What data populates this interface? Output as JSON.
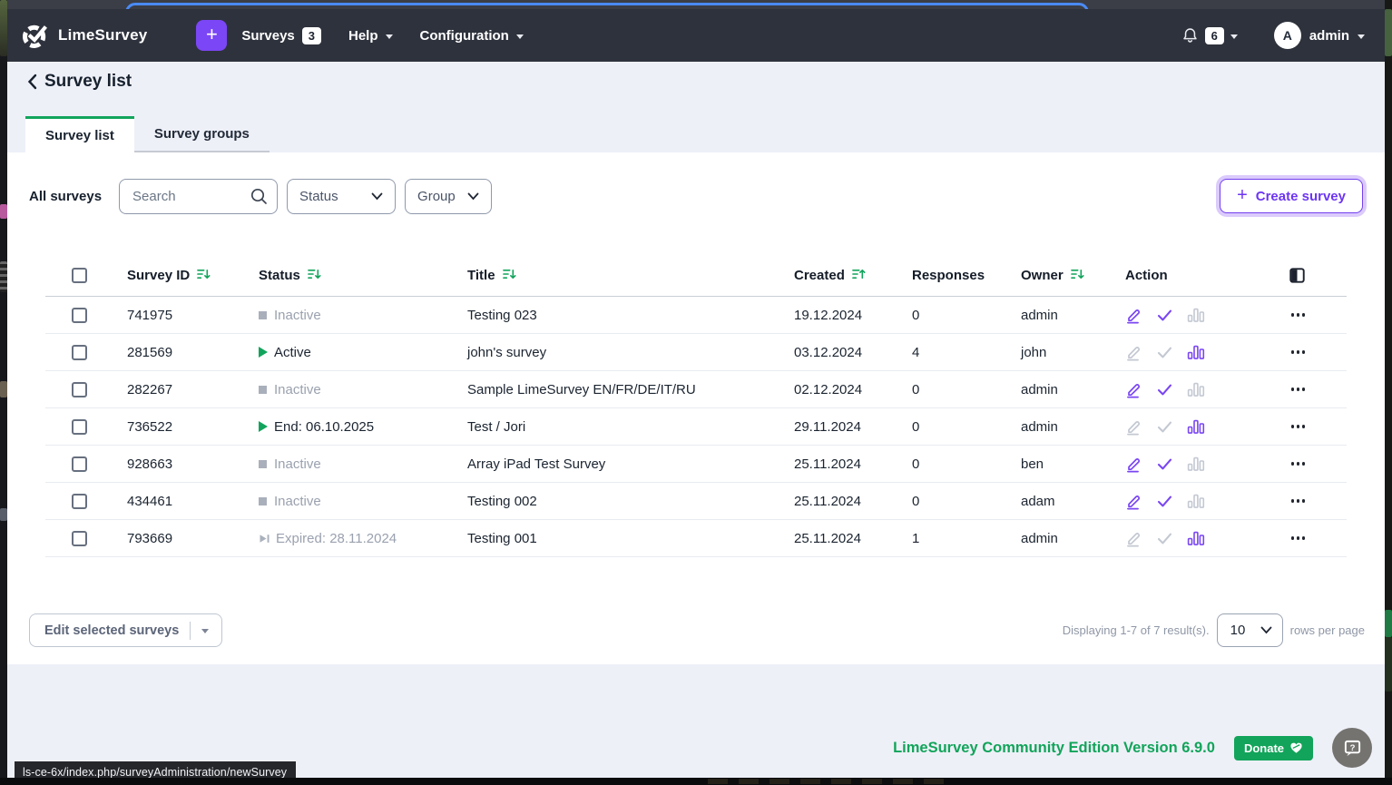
{
  "theme": {
    "accent_purple": "#7b46f5",
    "accent_green": "#12a45c",
    "navbar_bg": "#2e323c",
    "page_bg": "#eef0f8",
    "muted_text": "#9aa1ae"
  },
  "browser": {
    "status_bar_url": "ls-ce-6x/index.php/surveyAdministration/newSurvey"
  },
  "navbar": {
    "brand": "LimeSurvey",
    "plus_label": "+",
    "surveys_label": "Surveys",
    "surveys_badge": "3",
    "help_label": "Help",
    "config_label": "Configuration",
    "notifications_count": "6",
    "user_initial": "A",
    "user_name": "admin"
  },
  "page": {
    "back_title": "Survey list"
  },
  "tabs": [
    {
      "label": "Survey list"
    },
    {
      "label": "Survey groups"
    }
  ],
  "filters": {
    "scope_label": "All surveys",
    "search_placeholder": "Search",
    "status_placeholder": "Status",
    "group_placeholder": "Group",
    "create_button_label": "Create survey"
  },
  "table": {
    "columns": [
      {
        "label": "Survey ID",
        "sort": "down"
      },
      {
        "label": "Status",
        "sort": "down"
      },
      {
        "label": "Title",
        "sort": "down"
      },
      {
        "label": "Created",
        "sort": "up"
      },
      {
        "label": "Responses",
        "sort": null
      },
      {
        "label": "Owner",
        "sort": "down"
      },
      {
        "label": "Action",
        "sort": null
      }
    ],
    "rows": [
      {
        "id": "741975",
        "status_text": "Inactive",
        "status_type": "inactive",
        "title": "Testing 023",
        "created": "19.12.2024",
        "responses": "0",
        "owner": "admin"
      },
      {
        "id": "281569",
        "status_text": "Active",
        "status_type": "active",
        "title": "john's survey",
        "created": "03.12.2024",
        "responses": "4",
        "owner": "john"
      },
      {
        "id": "282267",
        "status_text": "Inactive",
        "status_type": "inactive",
        "title": "Sample LimeSurvey EN/FR/DE/IT/RU",
        "created": "02.12.2024",
        "responses": "0",
        "owner": "admin"
      },
      {
        "id": "736522",
        "status_text": "End: 06.10.2025",
        "status_type": "end",
        "title": "Test / Jori",
        "created": "29.11.2024",
        "responses": "0",
        "owner": "admin"
      },
      {
        "id": "928663",
        "status_text": "Inactive",
        "status_type": "inactive",
        "title": "Array iPad Test Survey",
        "created": "25.11.2024",
        "responses": "0",
        "owner": "ben"
      },
      {
        "id": "434461",
        "status_text": "Inactive",
        "status_type": "inactive",
        "title": "Testing 002",
        "created": "25.11.2024",
        "responses": "0",
        "owner": "adam"
      },
      {
        "id": "793669",
        "status_text": "Expired: 28.11.2024",
        "status_type": "expired",
        "title": "Testing 001",
        "created": "25.11.2024",
        "responses": "1",
        "owner": "admin"
      }
    ]
  },
  "list_footer": {
    "bulk_button_label": "Edit selected surveys",
    "summary": "Displaying 1-7 of 7 result(s).",
    "page_size_value": "10",
    "page_size_label": "rows per page"
  },
  "footer": {
    "version_text": "LimeSurvey Community Edition Version 6.9.0",
    "donate_label": "Donate"
  }
}
